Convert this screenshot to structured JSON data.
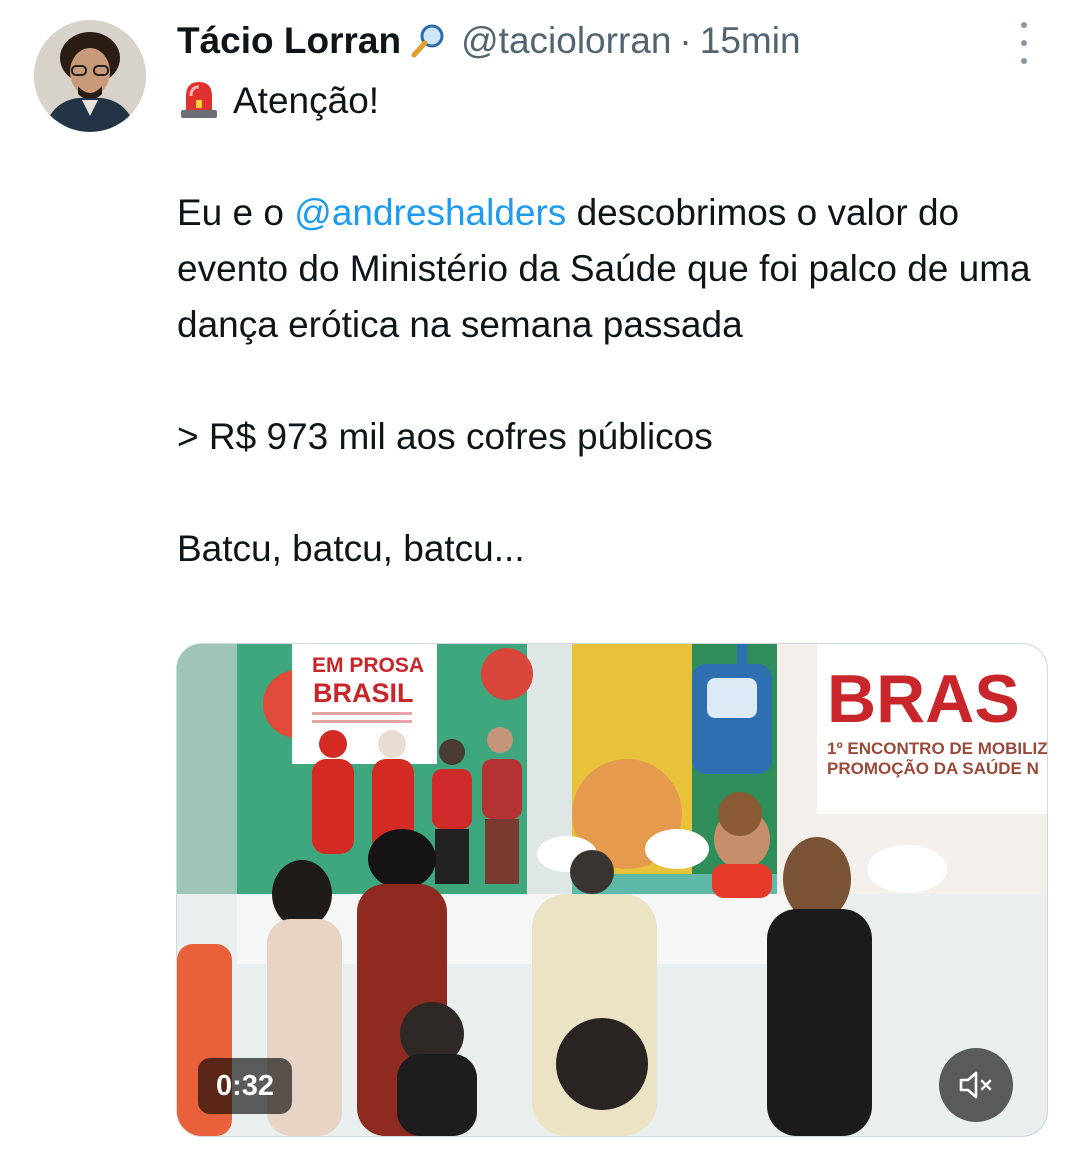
{
  "author": {
    "name": "Tácio Lorran",
    "handle": "@taciolorran",
    "separator": "·",
    "time": "15min",
    "badge_icon": "magnifying-glass-icon",
    "avatar_icon": "profile-photo"
  },
  "tweet": {
    "alert_icon": "police-siren-icon",
    "line1": "Atenção!",
    "para2_prefix": "Eu e o ",
    "mention": "@andreshalders",
    "para2_suffix": " descobrimos o valor do evento do Ministério da Saúde que foi palco de uma dança erótica na semana passada",
    "para3": "> R$ 973 mil aos cofres públicos",
    "para4": "Batcu, batcu, batcu..."
  },
  "video": {
    "duration": "0:32",
    "mute_icon": "speaker-muted-icon",
    "banner_left_line1": "EM PROSA",
    "banner_left_line2": "BRASIL",
    "banner_right_title": "BRAS",
    "banner_right_line1": "1º ENCONTRO DE MOBILIZ",
    "banner_right_line2": "PROMOÇÃO DA SAÚDE N"
  },
  "colors": {
    "text": "#0f1419",
    "secondary": "#536471",
    "link": "#1d9bf0",
    "banner_red": "#c8262b"
  }
}
